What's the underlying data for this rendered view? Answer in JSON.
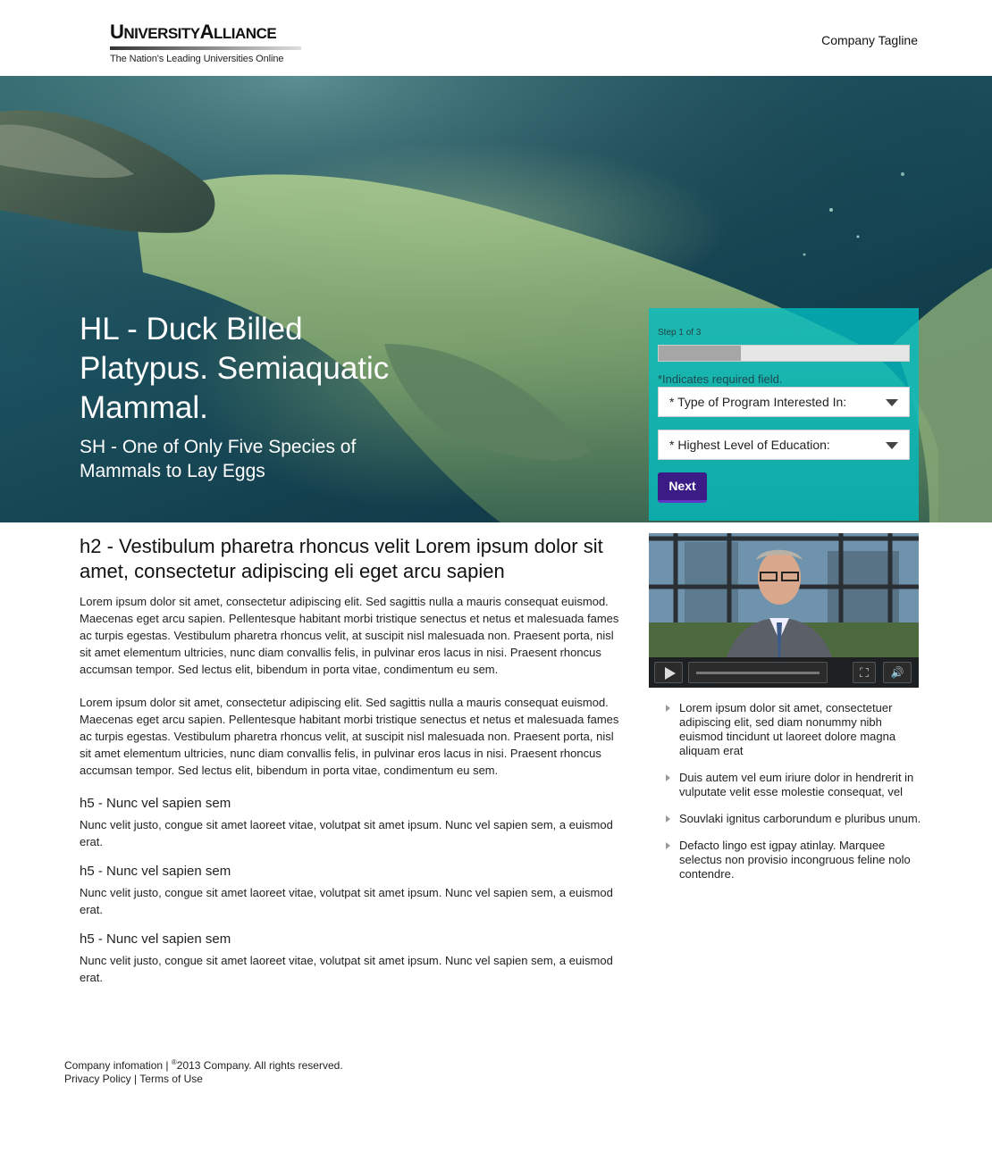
{
  "header": {
    "logo_word1_initial": "U",
    "logo_word1_rest": "NIVERSITY",
    "logo_word2_initial": "A",
    "logo_word2_rest": "LLIANCE",
    "logo_subtitle": "The Nation's Leading Universities Online",
    "tagline": "Company Tagline"
  },
  "hero": {
    "title": "HL - Duck Billed Platypus. Semiaquatic Mammal.",
    "subtitle": "SH - One of Only Five Species of Mammals to Lay Eggs"
  },
  "form": {
    "step_text": "Step 1 of 3",
    "progress_fraction": 0.33,
    "required_note": "*Indicates required field.",
    "program_select": "* Type of Program Interested In:",
    "education_select": "* Highest Level of Education:",
    "next_label": "Next",
    "panel_color": "#00bec3",
    "button_color": "#3b1b86"
  },
  "main": {
    "heading": "h2 - Vestibulum pharetra rhoncus velit Lorem ipsum dolor sit amet, consectetur adipiscing eli eget arcu sapien",
    "paragraph1": "Lorem ipsum dolor sit amet, consectetur adipiscing elit. Sed sagittis nulla a mauris consequat euismod. Maecenas eget arcu sapien. Pellentesque habitant morbi tristique senectus et netus et malesuada fames ac turpis egestas. Vestibulum pharetra rhoncus velit, at suscipit nisl malesuada non. Praesent porta, nisl sit amet elementum ultricies, nunc diam convallis felis, in pulvinar eros lacus in nisi. Praesent rhoncus accumsan tempor. Sed lectus elit, bibendum in porta vitae, condimentum eu sem.",
    "paragraph2": "Lorem ipsum dolor sit amet, consectetur adipiscing elit. Sed sagittis nulla a mauris consequat euismod. Maecenas eget arcu sapien. Pellentesque habitant morbi tristique senectus et netus et malesuada fames ac turpis egestas. Vestibulum pharetra rhoncus velit, at suscipit nisl malesuada non. Praesent porta, nisl sit amet elementum ultricies, nunc diam convallis felis, in pulvinar eros lacus in nisi. Praesent rhoncus accumsan tempor. Sed lectus elit, bibendum in porta vitae, condimentum eu sem.",
    "sections": [
      {
        "heading": "h5 - Nunc vel sapien sem",
        "text": "Nunc velit justo, congue sit amet laoreet vitae, volutpat sit amet ipsum. Nunc vel sapien sem, a euismod erat."
      },
      {
        "heading": "h5 - Nunc vel sapien sem",
        "text": "Nunc velit justo, congue sit amet laoreet vitae, volutpat sit amet ipsum. Nunc vel sapien sem, a euismod erat."
      },
      {
        "heading": "h5 - Nunc vel sapien sem",
        "text": "Nunc velit justo, congue sit amet laoreet vitae, volutpat sit amet ipsum. Nunc vel sapien sem, a euismod erat."
      }
    ]
  },
  "video": {
    "play_icon": "play-icon",
    "fullscreen_icon": "fullscreen-icon",
    "volume_icon": "volume-icon"
  },
  "bullets": [
    "Lorem ipsum dolor sit amet, consectetuer adipiscing elit, sed diam nonummy nibh euismod tincidunt ut laoreet dolore magna aliquam erat",
    "Duis autem vel eum iriure dolor in hendrerit in vulputate velit esse molestie consequat, vel",
    "Souvlaki ignitus carborundum e pluribus unum.",
    "Defacto lingo est igpay atinlay. Marquee selectus non provisio incongruous feline nolo contendre."
  ],
  "footer": {
    "company_info": "Company infomation",
    "separator": "|",
    "copyright_symbol": "®",
    "copyright_text": "2013 Company. All rights reserved.",
    "privacy": "Privacy Policy",
    "terms": "Terms of Use"
  }
}
